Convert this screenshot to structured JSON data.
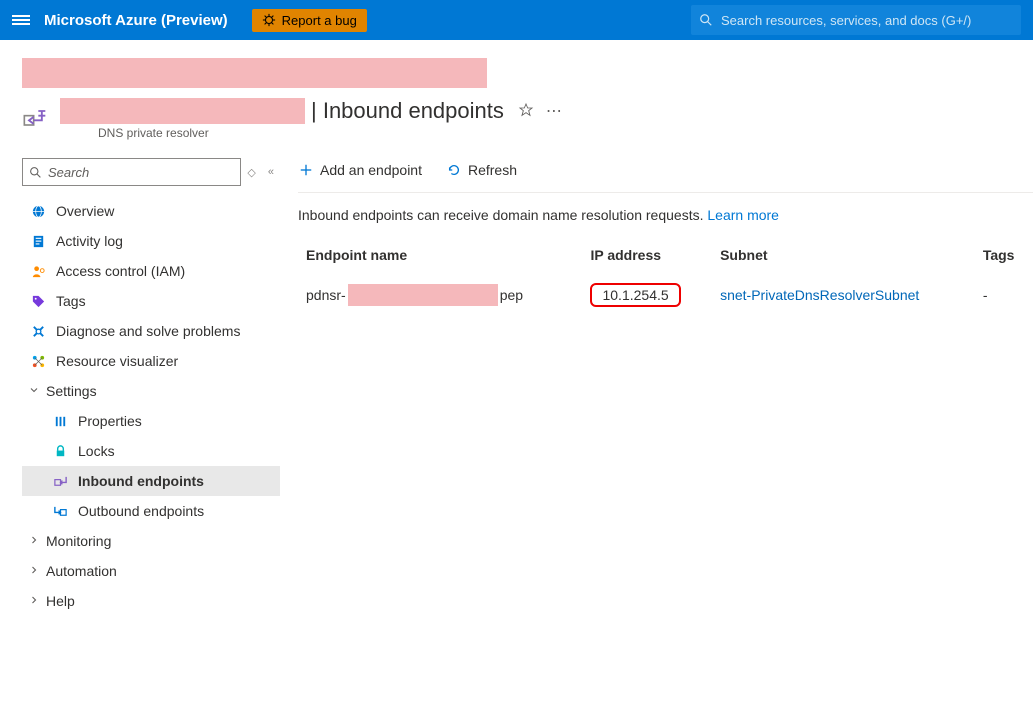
{
  "topbar": {
    "brand": "Microsoft Azure (Preview)",
    "bug_label": "Report a bug",
    "search_placeholder": "Search resources, services, and docs (G+/)"
  },
  "header": {
    "title_suffix": "| Inbound endpoints",
    "subtitle": "DNS private resolver"
  },
  "sidebar": {
    "search_placeholder": "Search",
    "items": [
      {
        "label": "Overview"
      },
      {
        "label": "Activity log"
      },
      {
        "label": "Access control (IAM)"
      },
      {
        "label": "Tags"
      },
      {
        "label": "Diagnose and solve problems"
      },
      {
        "label": "Resource visualizer"
      }
    ],
    "settings_label": "Settings",
    "settings": [
      {
        "label": "Properties"
      },
      {
        "label": "Locks"
      },
      {
        "label": "Inbound endpoints"
      },
      {
        "label": "Outbound endpoints"
      }
    ],
    "groups": [
      {
        "label": "Monitoring"
      },
      {
        "label": "Automation"
      },
      {
        "label": "Help"
      }
    ]
  },
  "commands": {
    "add": "Add an endpoint",
    "refresh": "Refresh"
  },
  "description": {
    "text": "Inbound endpoints can receive domain name resolution requests. ",
    "learn_more": "Learn more"
  },
  "table": {
    "headers": {
      "name": "Endpoint name",
      "ip": "IP address",
      "subnet": "Subnet",
      "tags": "Tags"
    },
    "rows": [
      {
        "name_prefix": "pdnsr-",
        "name_suffix": "pep",
        "ip": "10.1.254.5",
        "subnet": "snet-PrivateDnsResolverSubnet",
        "tags": "-"
      }
    ]
  }
}
